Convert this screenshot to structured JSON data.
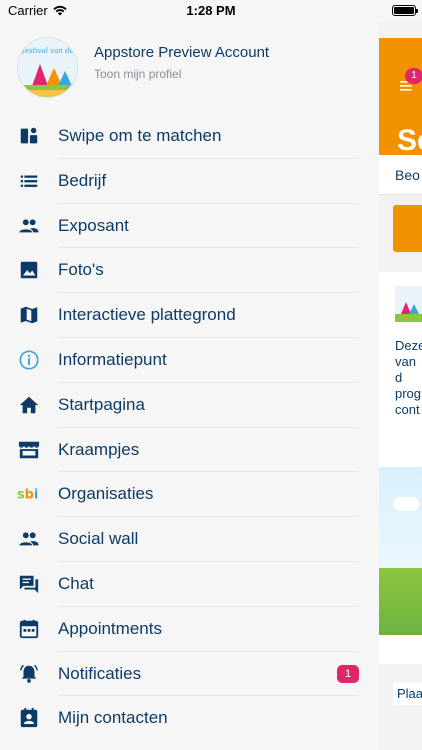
{
  "status_bar": {
    "carrier": "Carrier",
    "time": "1:28 PM"
  },
  "profile": {
    "name": "Appstore Preview Account",
    "subtitle": "Toon mijn profiel",
    "avatar_text": "festival van de"
  },
  "menu": {
    "items": [
      {
        "label": "Swipe om te matchen",
        "icon": "swipe-cards-icon"
      },
      {
        "label": "Bedrijf",
        "icon": "list-icon"
      },
      {
        "label": "Exposant",
        "icon": "people-icon"
      },
      {
        "label": "Foto's",
        "icon": "image-icon"
      },
      {
        "label": "Interactieve plattegrond",
        "icon": "map-icon"
      },
      {
        "label": "Informatiepunt",
        "icon": "info-icon"
      },
      {
        "label": "Startpagina",
        "icon": "home-icon"
      },
      {
        "label": "Kraampjes",
        "icon": "store-icon"
      },
      {
        "label": "Organisaties",
        "icon": "sbi-logo-icon",
        "icon_text": "sbi"
      },
      {
        "label": "Social wall",
        "icon": "people-icon"
      },
      {
        "label": "Chat",
        "icon": "chat-icon"
      },
      {
        "label": "Appointments",
        "icon": "calendar-icon"
      },
      {
        "label": "Notificaties",
        "icon": "bell-icon",
        "badge": "1"
      },
      {
        "label": "Mijn contacten",
        "icon": "contact-icon"
      }
    ]
  },
  "background": {
    "badge": "1",
    "title": "Se",
    "strip_text": "Beo",
    "card_text": "Deze\nvan d\nprog\ncont",
    "bottom_text": "Plaa"
  },
  "colors": {
    "drawer_bg": "#f6f6f6",
    "text_primary": "#0d3b66",
    "text_secondary": "#8a8f98",
    "accent_orange": "#f39200",
    "badge_pink": "#e0256d",
    "info_icon": "#3aa7d8"
  }
}
